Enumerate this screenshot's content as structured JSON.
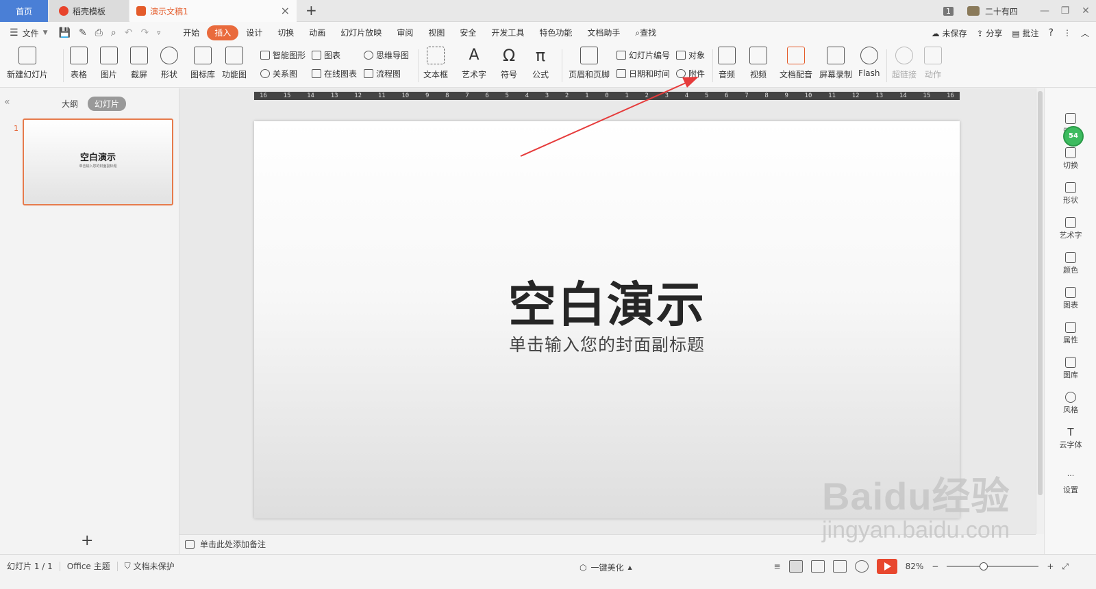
{
  "tabs": {
    "home": "首页",
    "template": "稻壳模板",
    "document": "演示文稿1"
  },
  "titlebar": {
    "page_count": "1",
    "user_name": "二十有四"
  },
  "menubar": {
    "file_label": "文件",
    "menus": [
      "开始",
      "插入",
      "设计",
      "切换",
      "动画",
      "幻灯片放映",
      "审阅",
      "视图",
      "安全",
      "开发工具",
      "特色功能",
      "文档助手"
    ],
    "active_menu": "插入",
    "search_label": "查找",
    "unsaved_label": "未保存",
    "share_label": "分享",
    "comment_label": "批注"
  },
  "ribbon": {
    "new_slide": "新建幻灯片",
    "table": "表格",
    "picture": "图片",
    "screenshot": "截屏",
    "shape": "形状",
    "icon_lib": "图标库",
    "function_chart": "功能图",
    "smart_art": "智能图形",
    "relation": "关系图",
    "chart": "图表",
    "online_chart": "在线图表",
    "mind_map": "思维导图",
    "flowchart": "流程图",
    "textbox": "文本框",
    "art_text": "艺术字",
    "symbol": "符号",
    "formula": "公式",
    "header_footer": "页眉和页脚",
    "slide_number": "幻灯片编号",
    "date_time": "日期和时间",
    "object": "对象",
    "attachment": "附件",
    "audio": "音频",
    "video": "视频",
    "doc_dub": "文档配音",
    "screen_rec": "屏幕录制",
    "flash": "Flash",
    "hyperlink": "超链接",
    "action": "动作"
  },
  "leftpanel": {
    "outline": "大纲",
    "slides": "幻灯片",
    "slide_number": "1",
    "thumb_title": "空白演示",
    "thumb_subtitle": "单击输入您的封面副标题"
  },
  "ruler": {
    "ticks": [
      "16",
      "15",
      "14",
      "13",
      "12",
      "11",
      "10",
      "9",
      "8",
      "7",
      "6",
      "5",
      "4",
      "3",
      "2",
      "1",
      "0",
      "1",
      "2",
      "3",
      "4",
      "5",
      "6",
      "7",
      "8",
      "9",
      "10",
      "11",
      "12",
      "13",
      "14",
      "15",
      "16"
    ]
  },
  "slide": {
    "title": "空白演示",
    "subtitle": "单击输入您的封面副标题"
  },
  "notes": {
    "placeholder": "单击此处添加备注"
  },
  "rightbar": {
    "items": [
      "动画",
      "切换",
      "形状",
      "艺术字",
      "颜色",
      "图表",
      "属性",
      "图库",
      "风格",
      "云字体",
      "设置"
    ],
    "badge": "54"
  },
  "statusbar": {
    "slide_info": "幻灯片 1 / 1",
    "theme": "Office 主题",
    "protection": "文档未保护",
    "beautify": "一键美化",
    "zoom": "82%"
  },
  "watermark": {
    "brand": "Baidu经验",
    "url": "jingyan.baidu.com"
  },
  "colors": {
    "accent": "#e96a3c",
    "home_tab": "#4a7fd6",
    "arrow": "#e63b3b",
    "play": "#e8472e"
  }
}
